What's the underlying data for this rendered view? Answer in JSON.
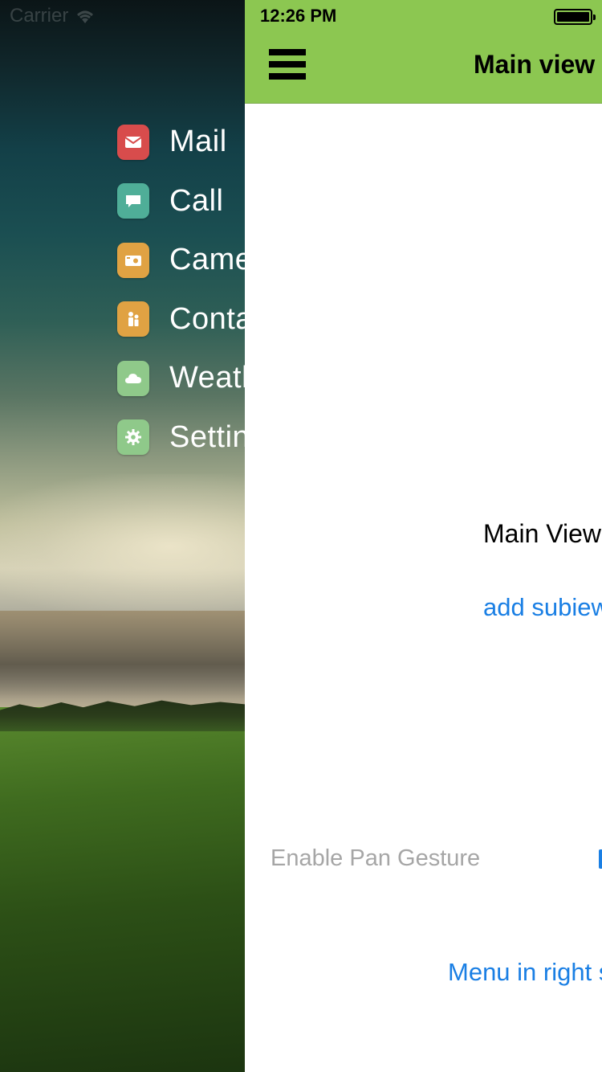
{
  "status_bar": {
    "carrier": "Carrier",
    "time": "12:26 PM"
  },
  "navbar": {
    "title": "Main view",
    "background_color": "#8cc751"
  },
  "menu": {
    "items": [
      {
        "label": "Mail",
        "icon": "mail-icon",
        "color": "#d84c4c"
      },
      {
        "label": "Call",
        "icon": "chat-bubble-icon",
        "color": "#4fae98"
      },
      {
        "label": "Camera",
        "icon": "camera-icon",
        "color": "#e0a243"
      },
      {
        "label": "Contacts",
        "icon": "contacts-icon",
        "color": "#e0a243"
      },
      {
        "label": "Weather",
        "icon": "cloud-icon",
        "color": "#8fc98a"
      },
      {
        "label": "Settings",
        "icon": "gear-icon",
        "color": "#8fc98a"
      }
    ]
  },
  "main": {
    "label": "Main View",
    "add_subview_link": "add subiew",
    "pan_gesture_label": "Enable Pan Gesture",
    "right_menu_link": "Menu in right side",
    "link_color": "#1a7fe4"
  }
}
